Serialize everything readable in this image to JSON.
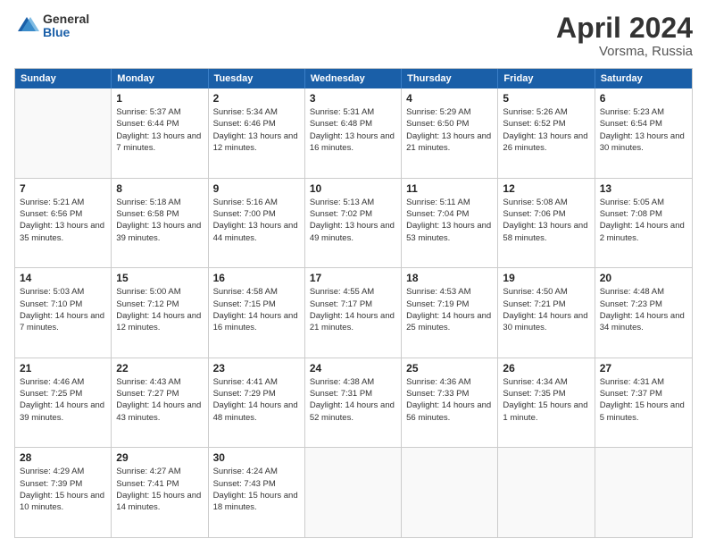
{
  "logo": {
    "general": "General",
    "blue": "Blue"
  },
  "title": {
    "month": "April 2024",
    "location": "Vorsma, Russia"
  },
  "header_days": [
    "Sunday",
    "Monday",
    "Tuesday",
    "Wednesday",
    "Thursday",
    "Friday",
    "Saturday"
  ],
  "rows": [
    [
      {
        "day": "",
        "sunrise": "",
        "sunset": "",
        "daylight": ""
      },
      {
        "day": "1",
        "sunrise": "Sunrise: 5:37 AM",
        "sunset": "Sunset: 6:44 PM",
        "daylight": "Daylight: 13 hours and 7 minutes."
      },
      {
        "day": "2",
        "sunrise": "Sunrise: 5:34 AM",
        "sunset": "Sunset: 6:46 PM",
        "daylight": "Daylight: 13 hours and 12 minutes."
      },
      {
        "day": "3",
        "sunrise": "Sunrise: 5:31 AM",
        "sunset": "Sunset: 6:48 PM",
        "daylight": "Daylight: 13 hours and 16 minutes."
      },
      {
        "day": "4",
        "sunrise": "Sunrise: 5:29 AM",
        "sunset": "Sunset: 6:50 PM",
        "daylight": "Daylight: 13 hours and 21 minutes."
      },
      {
        "day": "5",
        "sunrise": "Sunrise: 5:26 AM",
        "sunset": "Sunset: 6:52 PM",
        "daylight": "Daylight: 13 hours and 26 minutes."
      },
      {
        "day": "6",
        "sunrise": "Sunrise: 5:23 AM",
        "sunset": "Sunset: 6:54 PM",
        "daylight": "Daylight: 13 hours and 30 minutes."
      }
    ],
    [
      {
        "day": "7",
        "sunrise": "Sunrise: 5:21 AM",
        "sunset": "Sunset: 6:56 PM",
        "daylight": "Daylight: 13 hours and 35 minutes."
      },
      {
        "day": "8",
        "sunrise": "Sunrise: 5:18 AM",
        "sunset": "Sunset: 6:58 PM",
        "daylight": "Daylight: 13 hours and 39 minutes."
      },
      {
        "day": "9",
        "sunrise": "Sunrise: 5:16 AM",
        "sunset": "Sunset: 7:00 PM",
        "daylight": "Daylight: 13 hours and 44 minutes."
      },
      {
        "day": "10",
        "sunrise": "Sunrise: 5:13 AM",
        "sunset": "Sunset: 7:02 PM",
        "daylight": "Daylight: 13 hours and 49 minutes."
      },
      {
        "day": "11",
        "sunrise": "Sunrise: 5:11 AM",
        "sunset": "Sunset: 7:04 PM",
        "daylight": "Daylight: 13 hours and 53 minutes."
      },
      {
        "day": "12",
        "sunrise": "Sunrise: 5:08 AM",
        "sunset": "Sunset: 7:06 PM",
        "daylight": "Daylight: 13 hours and 58 minutes."
      },
      {
        "day": "13",
        "sunrise": "Sunrise: 5:05 AM",
        "sunset": "Sunset: 7:08 PM",
        "daylight": "Daylight: 14 hours and 2 minutes."
      }
    ],
    [
      {
        "day": "14",
        "sunrise": "Sunrise: 5:03 AM",
        "sunset": "Sunset: 7:10 PM",
        "daylight": "Daylight: 14 hours and 7 minutes."
      },
      {
        "day": "15",
        "sunrise": "Sunrise: 5:00 AM",
        "sunset": "Sunset: 7:12 PM",
        "daylight": "Daylight: 14 hours and 12 minutes."
      },
      {
        "day": "16",
        "sunrise": "Sunrise: 4:58 AM",
        "sunset": "Sunset: 7:15 PM",
        "daylight": "Daylight: 14 hours and 16 minutes."
      },
      {
        "day": "17",
        "sunrise": "Sunrise: 4:55 AM",
        "sunset": "Sunset: 7:17 PM",
        "daylight": "Daylight: 14 hours and 21 minutes."
      },
      {
        "day": "18",
        "sunrise": "Sunrise: 4:53 AM",
        "sunset": "Sunset: 7:19 PM",
        "daylight": "Daylight: 14 hours and 25 minutes."
      },
      {
        "day": "19",
        "sunrise": "Sunrise: 4:50 AM",
        "sunset": "Sunset: 7:21 PM",
        "daylight": "Daylight: 14 hours and 30 minutes."
      },
      {
        "day": "20",
        "sunrise": "Sunrise: 4:48 AM",
        "sunset": "Sunset: 7:23 PM",
        "daylight": "Daylight: 14 hours and 34 minutes."
      }
    ],
    [
      {
        "day": "21",
        "sunrise": "Sunrise: 4:46 AM",
        "sunset": "Sunset: 7:25 PM",
        "daylight": "Daylight: 14 hours and 39 minutes."
      },
      {
        "day": "22",
        "sunrise": "Sunrise: 4:43 AM",
        "sunset": "Sunset: 7:27 PM",
        "daylight": "Daylight: 14 hours and 43 minutes."
      },
      {
        "day": "23",
        "sunrise": "Sunrise: 4:41 AM",
        "sunset": "Sunset: 7:29 PM",
        "daylight": "Daylight: 14 hours and 48 minutes."
      },
      {
        "day": "24",
        "sunrise": "Sunrise: 4:38 AM",
        "sunset": "Sunset: 7:31 PM",
        "daylight": "Daylight: 14 hours and 52 minutes."
      },
      {
        "day": "25",
        "sunrise": "Sunrise: 4:36 AM",
        "sunset": "Sunset: 7:33 PM",
        "daylight": "Daylight: 14 hours and 56 minutes."
      },
      {
        "day": "26",
        "sunrise": "Sunrise: 4:34 AM",
        "sunset": "Sunset: 7:35 PM",
        "daylight": "Daylight: 15 hours and 1 minute."
      },
      {
        "day": "27",
        "sunrise": "Sunrise: 4:31 AM",
        "sunset": "Sunset: 7:37 PM",
        "daylight": "Daylight: 15 hours and 5 minutes."
      }
    ],
    [
      {
        "day": "28",
        "sunrise": "Sunrise: 4:29 AM",
        "sunset": "Sunset: 7:39 PM",
        "daylight": "Daylight: 15 hours and 10 minutes."
      },
      {
        "day": "29",
        "sunrise": "Sunrise: 4:27 AM",
        "sunset": "Sunset: 7:41 PM",
        "daylight": "Daylight: 15 hours and 14 minutes."
      },
      {
        "day": "30",
        "sunrise": "Sunrise: 4:24 AM",
        "sunset": "Sunset: 7:43 PM",
        "daylight": "Daylight: 15 hours and 18 minutes."
      },
      {
        "day": "",
        "sunrise": "",
        "sunset": "",
        "daylight": ""
      },
      {
        "day": "",
        "sunrise": "",
        "sunset": "",
        "daylight": ""
      },
      {
        "day": "",
        "sunrise": "",
        "sunset": "",
        "daylight": ""
      },
      {
        "day": "",
        "sunrise": "",
        "sunset": "",
        "daylight": ""
      }
    ]
  ]
}
